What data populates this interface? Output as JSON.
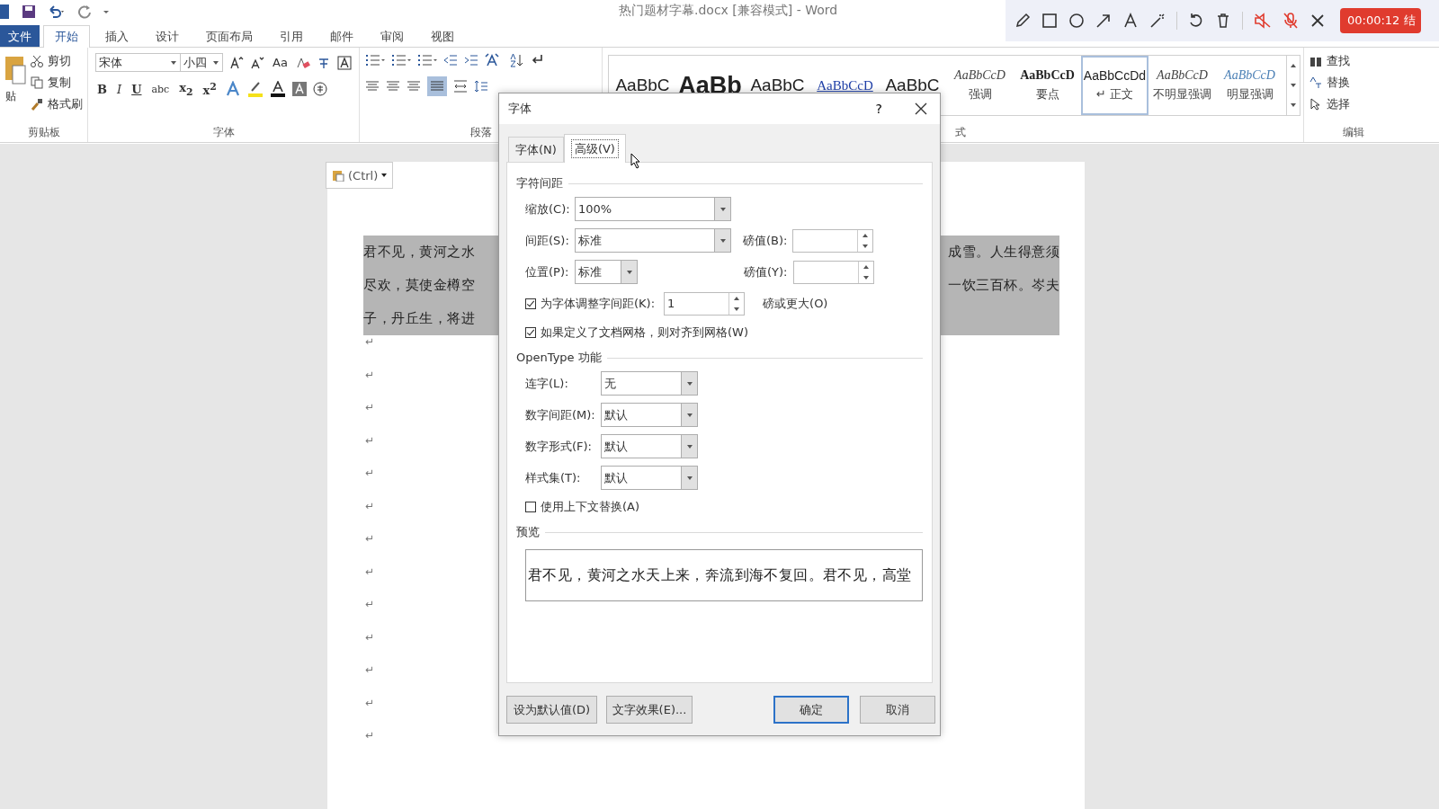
{
  "title_bar": {
    "title": "热门题材字幕.docx [兼容模式] - Word"
  },
  "recording_toolbar": {
    "timer": "00:00:12 结"
  },
  "ribbon_tabs": [
    {
      "label": "文件",
      "kind": "file",
      "selected": false
    },
    {
      "label": "开始",
      "kind": "tab",
      "selected": true
    },
    {
      "label": "插入",
      "kind": "tab",
      "selected": false
    },
    {
      "label": "设计",
      "kind": "tab",
      "selected": false
    },
    {
      "label": "页面布局",
      "kind": "tab",
      "selected": false
    },
    {
      "label": "引用",
      "kind": "tab",
      "selected": false
    },
    {
      "label": "邮件",
      "kind": "tab",
      "selected": false
    },
    {
      "label": "审阅",
      "kind": "tab",
      "selected": false
    },
    {
      "label": "视图",
      "kind": "tab",
      "selected": false
    }
  ],
  "clipboard": {
    "paste": "贴",
    "cut": "剪切",
    "copy": "复制",
    "format_painter": "格式刷",
    "group_label": "剪贴板"
  },
  "font": {
    "name": "宋体",
    "size": "小四",
    "change_case": "Aa",
    "format_buttons": [
      "B",
      "I",
      "U",
      "abc",
      "x$_{2}$",
      "x$^{2}$"
    ],
    "group_label": "字体"
  },
  "paragraph": {
    "group_label": "段落"
  },
  "styles": {
    "group_label": "式",
    "items": [
      {
        "sample": "AaBbC",
        "kind": "heading1",
        "selected": false
      },
      {
        "sample": "AaBb",
        "kind": "title",
        "selected": false
      },
      {
        "sample": "AaBbC",
        "kind": "heading2",
        "selected": false
      },
      {
        "sample": "AaBbCcD",
        "kind": "link",
        "selected": false
      },
      {
        "sample": "AaBbC",
        "kind": "heading3",
        "selected": false
      },
      {
        "sample": "AaBbCcD",
        "label": "强调",
        "kind": "emphasis",
        "selected": false
      },
      {
        "sample": "AaBbCcD",
        "label": "要点",
        "kind": "strong",
        "selected": false
      },
      {
        "sample": "AaBbCcDd",
        "label": "↵ 正文",
        "kind": "normal",
        "selected": true
      },
      {
        "sample": "AaBbCcD",
        "label": "不明显强调",
        "kind": "emphasis",
        "selected": false
      },
      {
        "sample": "AaBbCcD",
        "label": "明显强调",
        "kind": "intense",
        "selected": false
      }
    ]
  },
  "editing": {
    "find": "查找",
    "replace": "替换",
    "select": "选择",
    "group_label": "编辑"
  },
  "paste_options": {
    "label": "(Ctrl)"
  },
  "document": {
    "lines": [
      {
        "left": "君不见，黄河之水",
        "right": "成雪。人生得意须"
      },
      {
        "left": "尽欢，莫使金樽空",
        "right": "一饮三百杯。岑夫"
      },
      {
        "left": "子，丹丘生，将进"
      }
    ],
    "paragraph_marks": [
      "↵",
      "↵",
      "↵",
      "↵",
      "↵",
      "↵",
      "↵",
      "↵",
      "↵",
      "↵",
      "↵",
      "↵",
      "↵"
    ]
  },
  "dialog": {
    "title": "字体",
    "help": "?",
    "tabs": [
      {
        "label": "字体(N)",
        "selected": false
      },
      {
        "label": "高级(V)",
        "selected": true
      }
    ],
    "spacing_section": "字符间距",
    "scale": {
      "label": "缩放(C):",
      "value": "100%"
    },
    "spacing": {
      "label": "间距(S):",
      "value": "标准",
      "points_label": "磅值(B):"
    },
    "position": {
      "label": "位置(P):",
      "value": "标准",
      "points_label": "磅值(Y):"
    },
    "kerning": {
      "label": "为字体调整字间距(K):",
      "checked": true,
      "value": "1",
      "suffix": "磅或更大(O)"
    },
    "snap_grid": {
      "label": "如果定义了文档网格，则对齐到网格(W)",
      "checked": true
    },
    "opentype_section": "OpenType 功能",
    "opentype": [
      {
        "label": "连字(L):",
        "value": "无"
      },
      {
        "label": "数字间距(M):",
        "value": "默认"
      },
      {
        "label": "数字形式(F):",
        "value": "默认"
      },
      {
        "label": "样式集(T):",
        "value": "默认"
      }
    ],
    "contextual": {
      "label": "使用上下文替换(A)",
      "checked": false
    },
    "preview_section": "预览",
    "preview_text": "君不见，黄河之水天上来，奔流到海不复回。君不见，高堂",
    "buttons": [
      {
        "label": "设为默认值(D)",
        "kind": "normal"
      },
      {
        "label": "文字效果(E)...",
        "kind": "normal"
      },
      {
        "label": "确定",
        "kind": "default"
      },
      {
        "label": "取消",
        "kind": "normal"
      }
    ]
  }
}
